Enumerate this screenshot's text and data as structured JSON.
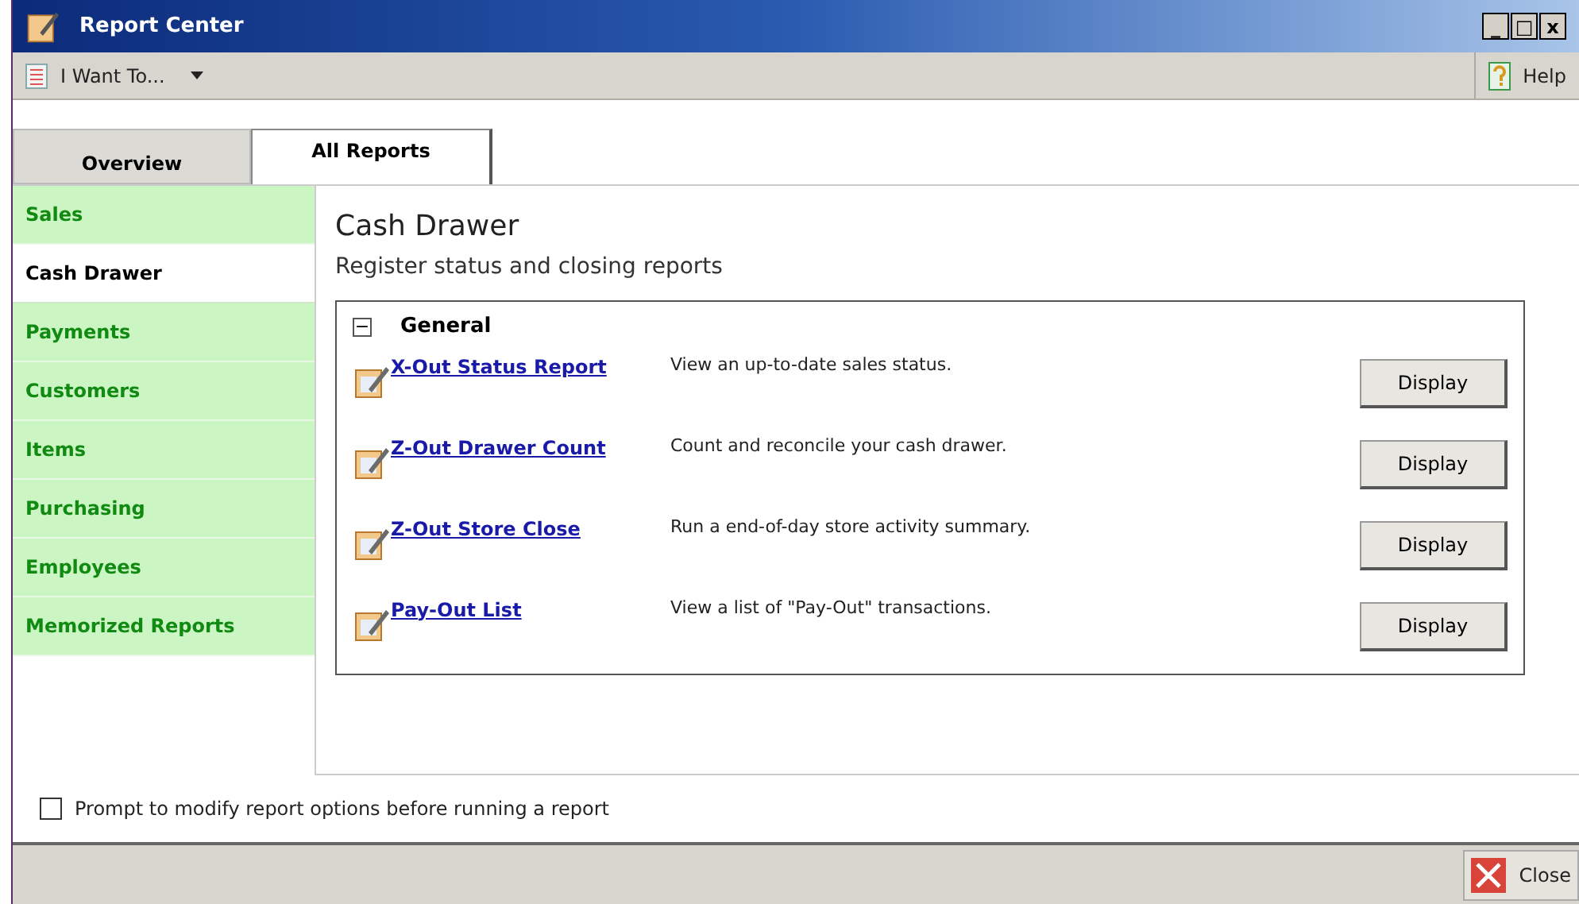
{
  "window": {
    "title": "Report Center",
    "controls": [
      "_",
      "□",
      "x"
    ]
  },
  "toolbar": {
    "menu": "I Want To...",
    "help": "Help"
  },
  "tabs": [
    {
      "label": "Overview",
      "selected": false
    },
    {
      "label": "All Reports",
      "selected": true
    }
  ],
  "sidebar": {
    "items": [
      {
        "label": "Sales",
        "selected": false
      },
      {
        "label": "Cash Drawer",
        "selected": true
      },
      {
        "label": "Payments",
        "selected": false
      },
      {
        "label": "Customers",
        "selected": false
      },
      {
        "label": "Items",
        "selected": false
      },
      {
        "label": "Purchasing",
        "selected": false
      },
      {
        "label": "Employees",
        "selected": false
      },
      {
        "label": "Memorized Reports",
        "selected": false
      }
    ]
  },
  "content": {
    "title": "Cash Drawer",
    "subtitle": "Register status and closing reports",
    "group": {
      "title": "General",
      "expanded": true,
      "toggle": "−",
      "reports": [
        {
          "name": "X-Out Status Report",
          "description": "View an up-to-date sales status.",
          "button": "Display"
        },
        {
          "name": "Z-Out Drawer Count",
          "description": "Count and reconcile your cash drawer.",
          "button": "Display"
        },
        {
          "name": "Z-Out Store Close",
          "description": "Run a end-of-day store activity summary.",
          "button": "Display"
        },
        {
          "name": "Pay-Out List",
          "description": "View a list of \"Pay-Out\" transactions.",
          "button": "Display"
        }
      ]
    }
  },
  "prompt_option": {
    "label": "Prompt to modify report options before running a report",
    "checked": false
  },
  "footer": {
    "close": "Close"
  }
}
